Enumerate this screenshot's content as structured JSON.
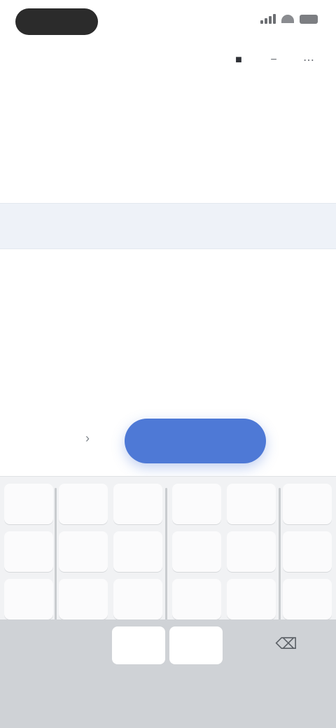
{
  "status_bar": {
    "time": "",
    "icons": [
      "signal-icon",
      "wifi-icon",
      "battery-icon"
    ]
  },
  "header": {
    "back_label": "",
    "actions": [
      "notifications-icon",
      "share-icon",
      "more-icon"
    ],
    "title": "",
    "subtitle": ""
  },
  "picker": {
    "rows": [
      {
        "label": "",
        "value": "",
        "side": ""
      },
      {
        "label": "",
        "value": "",
        "side": ""
      },
      {
        "label": "",
        "value": "",
        "side": ""
      },
      {
        "label": "",
        "value": "",
        "side": ""
      },
      {
        "label": "",
        "value": "",
        "side": ""
      }
    ],
    "selected_index": 2
  },
  "actions": {
    "left_label": "",
    "arrow_icon": "arrow-right-icon",
    "primary_label": "",
    "right_label": ""
  },
  "keyboard": {
    "keys": [
      "",
      "",
      "",
      "",
      "",
      "",
      "",
      "",
      "",
      "",
      "",
      "",
      "",
      "",
      "",
      "",
      "",
      ""
    ],
    "bottom_keys": [
      "",
      ""
    ],
    "backspace_icon": "backspace-icon"
  },
  "colors": {
    "accent": "#4e79d6",
    "keyboard_bg": "#f1f2f4",
    "keyboard_bottom": "#cfd2d6"
  }
}
